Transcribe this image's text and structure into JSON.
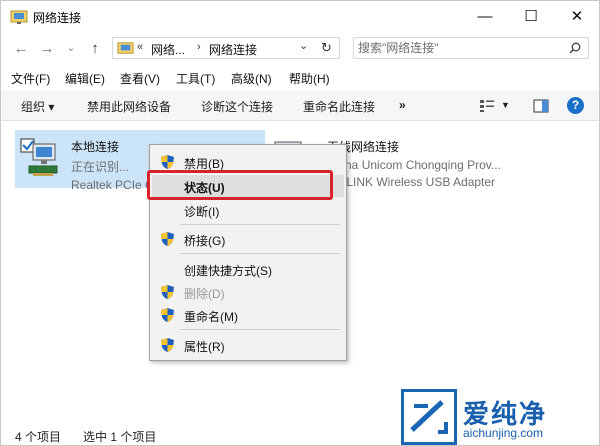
{
  "window": {
    "title": "网络连接",
    "controls": {
      "minimize": "—",
      "maximize": "☐",
      "close": "✕"
    }
  },
  "address": {
    "overflow": "«",
    "crumb1": "网络...",
    "sep": "›",
    "crumb2": "网络连接",
    "dropdown": "⌄",
    "refresh": "↻",
    "search_placeholder": "搜索\"网络连接\""
  },
  "menu": [
    "文件(F)",
    "编辑(E)",
    "查看(V)",
    "工具(T)",
    "高级(N)",
    "帮助(H)"
  ],
  "commands": {
    "organize": "组织 ▾",
    "disable": "禁用此网络设备",
    "diagnose": "诊断这个连接",
    "rename": "重命名此连接",
    "more": "»",
    "help": "?"
  },
  "items": [
    {
      "name": "本地连接",
      "status": "正在识别...",
      "adapter": "Realtek PCIe GbE Family Controller"
    },
    {
      "name": "无线网络连接",
      "status": "China Unicom Chongqing Prov...",
      "adapter": "TP-LINK Wireless USB Adapter"
    }
  ],
  "context_menu": [
    {
      "label": "禁用(B)",
      "shield": true
    },
    {
      "label": "状态(U)",
      "shield": false
    },
    {
      "label": "诊断(I)",
      "shield": false
    },
    {
      "label": "桥接(G)",
      "shield": true
    },
    {
      "label": "创建快捷方式(S)",
      "shield": false
    },
    {
      "label": "删除(D)",
      "shield": true
    },
    {
      "label": "重命名(M)",
      "shield": true
    },
    {
      "label": "属性(R)",
      "shield": true
    }
  ],
  "status": {
    "count": "4 个项目",
    "selected": "选中 1 个项目"
  },
  "watermark": {
    "text": "爱纯净",
    "url": "aichunjing.com"
  },
  "colors": {
    "selection": "#cce4f7",
    "highlight_box": "#d8232a",
    "watermark": "#1a5fae"
  }
}
